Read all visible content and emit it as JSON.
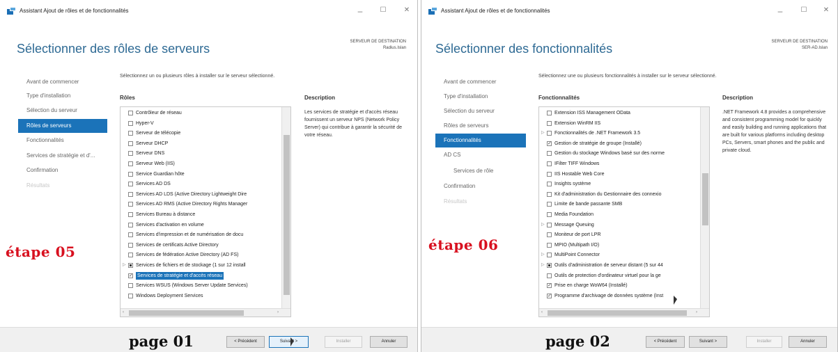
{
  "window1": {
    "title": "Assistant Ajout de rôles et de fonctionnalités",
    "heading": "Sélectionner des rôles de serveurs",
    "destination_label": "SERVEUR DE DESTINATION",
    "destination_server": "Radius.Islan",
    "nav": [
      {
        "label": "Avant de commencer",
        "state": "normal"
      },
      {
        "label": "Type d'installation",
        "state": "normal"
      },
      {
        "label": "Sélection du serveur",
        "state": "normal"
      },
      {
        "label": "Rôles de serveurs",
        "state": "active"
      },
      {
        "label": "Fonctionnalités",
        "state": "normal"
      },
      {
        "label": "Services de stratégie et d'...",
        "state": "normal"
      },
      {
        "label": "Confirmation",
        "state": "normal"
      },
      {
        "label": "Résultats",
        "state": "disabled"
      }
    ],
    "intro": "Sélectionnez un ou plusieurs rôles à installer sur le serveur sélectionné.",
    "list_header": "Rôles",
    "description_header": "Description",
    "description_text": "Les services de stratégie et d'accès réseau fournissent un serveur NPS (Network Policy Server) qui contribue à garantir la sécurité de votre réseau.",
    "roles": [
      {
        "label": "Contrôleur de réseau",
        "checked": false
      },
      {
        "label": "Hyper-V",
        "checked": false
      },
      {
        "label": "Serveur de télécopie",
        "checked": false
      },
      {
        "label": "Serveur DHCP",
        "checked": false
      },
      {
        "label": "Serveur DNS",
        "checked": false
      },
      {
        "label": "Serveur Web (IIS)",
        "checked": false
      },
      {
        "label": "Service Guardian hôte",
        "checked": false
      },
      {
        "label": "Services AD DS",
        "checked": false
      },
      {
        "label": "Services AD LDS (Active Directory Lightweight Dire",
        "checked": false
      },
      {
        "label": "Services AD RMS (Active Directory Rights Manager",
        "checked": false
      },
      {
        "label": "Services Bureau à distance",
        "checked": false
      },
      {
        "label": "Services d'activation en volume",
        "checked": false
      },
      {
        "label": "Services d'impression et de numérisation de docu",
        "checked": false
      },
      {
        "label": "Services de certificats Active Directory",
        "checked": false
      },
      {
        "label": "Services de fédération Active Directory (AD FS)",
        "checked": false
      },
      {
        "label": "Services de fichiers et de stockage (1 sur 12 install",
        "checked": "partial",
        "expander": true
      },
      {
        "label": "Services de stratégie et d'accès réseau",
        "checked": true,
        "selected": true
      },
      {
        "label": "Services WSUS (Windows Server Update Services)",
        "checked": false
      },
      {
        "label": "Windows Deployment Services",
        "checked": false
      }
    ],
    "step_label": "étape 05",
    "page_label": "page 01",
    "buttons": {
      "prev": "< Précédent",
      "next": "Suivant >",
      "install": "Installer",
      "cancel": "Annuler"
    }
  },
  "window2": {
    "title": "Assistant Ajout de rôles et de fonctionnalités",
    "heading": "Sélectionner des fonctionnalités",
    "destination_label": "SERVEUR DE DESTINATION",
    "destination_server": "SER-AD.Islan",
    "nav": [
      {
        "label": "Avant de commencer",
        "state": "normal"
      },
      {
        "label": "Type d'installation",
        "state": "normal"
      },
      {
        "label": "Sélection du serveur",
        "state": "normal"
      },
      {
        "label": "Rôles de serveurs",
        "state": "normal"
      },
      {
        "label": "Fonctionnalités",
        "state": "active"
      },
      {
        "label": "AD CS",
        "state": "normal"
      },
      {
        "label": "Services de rôle",
        "state": "sub"
      },
      {
        "label": "Confirmation",
        "state": "normal"
      },
      {
        "label": "Résultats",
        "state": "disabled"
      }
    ],
    "intro": "Sélectionnez une ou plusieurs fonctionnalités à installer sur le serveur sélectionné.",
    "list_header": "Fonctionnalités",
    "description_header": "Description",
    "description_text": ".NET Framework 4.8 provides a comprehensive and consistent programming model for quickly and easily building and running applications that are built for various platforms including desktop PCs, Servers, smart phones and the public and private cloud.",
    "features": [
      {
        "label": "Extension ISS Management OData",
        "checked": false
      },
      {
        "label": "Extension WinRM IIS",
        "checked": false
      },
      {
        "label": "Fonctionnalités de .NET Framework 3.5",
        "checked": false,
        "expander": true
      },
      {
        "label": "Gestion de stratégie de groupe (Installé)",
        "checked": true
      },
      {
        "label": "Gestion du stockage Windows basé sur des norme",
        "checked": false
      },
      {
        "label": "IFilter TIFF Windows",
        "checked": false
      },
      {
        "label": "IIS Hostable Web Core",
        "checked": false
      },
      {
        "label": "Insights système",
        "checked": false
      },
      {
        "label": "Kit d'administration du Gestionnaire des connexio",
        "checked": false
      },
      {
        "label": "Limite de bande passante SMB",
        "checked": false
      },
      {
        "label": "Media Foundation",
        "checked": false
      },
      {
        "label": "Message Queuing",
        "checked": false,
        "expander": true
      },
      {
        "label": "Moniteur de port LPR",
        "checked": false
      },
      {
        "label": "MPIO (Multipath I/O)",
        "checked": false
      },
      {
        "label": "MultiPoint Connector",
        "checked": false,
        "expander": true
      },
      {
        "label": "Outils d'administration de serveur distant (5 sur 44",
        "checked": "partial",
        "expander": true
      },
      {
        "label": "Outils de protection d'ordinateur virtuel pour la ge",
        "checked": false
      },
      {
        "label": "Prise en charge WoW64 (Installé)",
        "checked": true
      },
      {
        "label": "Programme d'archivage de données système (Inst",
        "checked": true
      }
    ],
    "step_label": "étape 06",
    "page_label": "page 02",
    "buttons": {
      "prev": "< Précédent",
      "next": "Suivant >",
      "install": "Installer",
      "cancel": "Annuler"
    }
  },
  "window_controls": {
    "minimize": "–",
    "maximize": "☐",
    "close": "✕"
  },
  "colors": {
    "accent": "#1b73b9",
    "heading": "#2e6a94",
    "step_red": "#d8101f"
  }
}
